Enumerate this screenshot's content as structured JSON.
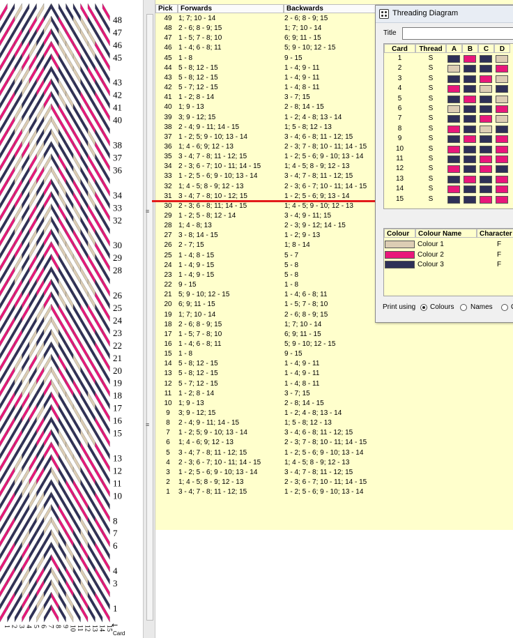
{
  "colors": {
    "colour1": "#dccdb4",
    "colour2": "#e8177a",
    "colour3": "#2e3057",
    "panel": "#ffffcc",
    "marker": "#e21b1b"
  },
  "pattern": {
    "pick_labels": [
      "48",
      "47",
      "46",
      "45",
      "43",
      "42",
      "41",
      "40",
      "38",
      "37",
      "36",
      "34",
      "33",
      "32",
      "30",
      "29",
      "28",
      "26",
      "25",
      "24",
      "23",
      "22",
      "21",
      "20",
      "19",
      "18",
      "17",
      "16",
      "15",
      "13",
      "12",
      "11",
      "10",
      "8",
      "7",
      "6",
      "4",
      "3",
      "1"
    ],
    "card_numbers": [
      "1",
      "2",
      "3",
      "4",
      "5",
      "6",
      "7",
      "8",
      "9",
      "10",
      "11",
      "12",
      "13",
      "14",
      "15"
    ],
    "card_label": "Card"
  },
  "table": {
    "headers": {
      "pick": "Pick",
      "forwards": "Forwards",
      "backwards": "Backwards"
    },
    "rows": [
      {
        "pick": "49",
        "f": "1; 7; 10 - 14",
        "b": "2 - 6; 8 - 9; 15"
      },
      {
        "pick": "48",
        "f": "2 - 6; 8 - 9; 15",
        "b": "1; 7; 10 - 14"
      },
      {
        "pick": "47",
        "f": "1 - 5; 7 - 8; 10",
        "b": "6; 9; 11 - 15"
      },
      {
        "pick": "46",
        "f": "1 - 4; 6 - 8; 11",
        "b": "5; 9 - 10; 12 - 15"
      },
      {
        "pick": "45",
        "f": "1 - 8",
        "b": "9 - 15"
      },
      {
        "pick": "44",
        "f": "5 - 8; 12 - 15",
        "b": "1 - 4; 9 - 11"
      },
      {
        "pick": "43",
        "f": "5 - 8; 12 - 15",
        "b": "1 - 4; 9 - 11"
      },
      {
        "pick": "42",
        "f": "5 - 7; 12 - 15",
        "b": "1 - 4; 8 - 11"
      },
      {
        "pick": "41",
        "f": "1 - 2; 8 - 14",
        "b": "3 - 7; 15"
      },
      {
        "pick": "40",
        "f": "1; 9 - 13",
        "b": "2 - 8; 14 - 15"
      },
      {
        "pick": "39",
        "f": "3; 9 - 12; 15",
        "b": "1 - 2; 4 - 8; 13 - 14"
      },
      {
        "pick": "38",
        "f": "2 - 4; 9 - 11; 14 - 15",
        "b": "1; 5 - 8; 12 - 13"
      },
      {
        "pick": "37",
        "f": "1 - 2; 5; 9 - 10; 13 - 14",
        "b": "3 - 4; 6 - 8; 11 - 12; 15"
      },
      {
        "pick": "36",
        "f": "1; 4 - 6; 9; 12 - 13",
        "b": "2 - 3; 7 - 8; 10 - 11; 14 - 15"
      },
      {
        "pick": "35",
        "f": "3 - 4; 7 - 8; 11 - 12; 15",
        "b": "1 - 2; 5 - 6; 9 - 10; 13 - 14"
      },
      {
        "pick": "34",
        "f": "2 - 3; 6 - 7; 10 - 11; 14 - 15",
        "b": "1; 4 - 5; 8 - 9; 12 - 13"
      },
      {
        "pick": "33",
        "f": "1 - 2; 5 - 6; 9 - 10; 13 - 14",
        "b": "3 - 4; 7 - 8; 11 - 12; 15"
      },
      {
        "pick": "32",
        "f": "1; 4 - 5; 8 - 9; 12 - 13",
        "b": "2 - 3; 6 - 7; 10 - 11; 14 - 15"
      },
      {
        "pick": "31",
        "f": "3 - 4; 7 - 8; 10 - 12; 15",
        "b": "1 - 2; 5 - 6; 9; 13 - 14"
      },
      {
        "pick": "30",
        "f": "2 - 3; 6 - 8; 11; 14 - 15",
        "b": "1; 4 - 5; 9 - 10; 12 - 13"
      },
      {
        "pick": "29",
        "f": "1 - 2; 5 - 8; 12 - 14",
        "b": "3 - 4; 9 - 11; 15"
      },
      {
        "pick": "28",
        "f": "1; 4 - 8; 13",
        "b": "2 - 3; 9 - 12; 14 - 15"
      },
      {
        "pick": "27",
        "f": "3 - 8; 14 - 15",
        "b": "1 - 2; 9 - 13"
      },
      {
        "pick": "26",
        "f": "2 - 7; 15",
        "b": "1; 8 - 14"
      },
      {
        "pick": "25",
        "f": "1 - 4; 8 - 15",
        "b": "5 - 7"
      },
      {
        "pick": "24",
        "f": "1 - 4; 9 - 15",
        "b": "5 - 8"
      },
      {
        "pick": "23",
        "f": "1 - 4; 9 - 15",
        "b": "5 - 8"
      },
      {
        "pick": "22",
        "f": "9 - 15",
        "b": "1 - 8"
      },
      {
        "pick": "21",
        "f": "5; 9 - 10; 12 - 15",
        "b": "1 - 4; 6 - 8; 11"
      },
      {
        "pick": "20",
        "f": "6; 9; 11 - 15",
        "b": "1 - 5; 7 - 8; 10"
      },
      {
        "pick": "19",
        "f": "1; 7; 10 - 14",
        "b": "2 - 6; 8 - 9; 15"
      },
      {
        "pick": "18",
        "f": "2 - 6; 8 - 9; 15",
        "b": "1; 7; 10 - 14"
      },
      {
        "pick": "17",
        "f": "1 - 5; 7 - 8; 10",
        "b": "6; 9; 11 - 15"
      },
      {
        "pick": "16",
        "f": "1 - 4; 6 - 8; 11",
        "b": "5; 9 - 10; 12 - 15"
      },
      {
        "pick": "15",
        "f": "1 - 8",
        "b": "9 - 15"
      },
      {
        "pick": "14",
        "f": "5 - 8; 12 - 15",
        "b": "1 - 4; 9 - 11"
      },
      {
        "pick": "13",
        "f": "5 - 8; 12 - 15",
        "b": "1 - 4; 9 - 11"
      },
      {
        "pick": "12",
        "f": "5 - 7; 12 - 15",
        "b": "1 - 4; 8 - 11"
      },
      {
        "pick": "11",
        "f": "1 - 2; 8 - 14",
        "b": "3 - 7; 15"
      },
      {
        "pick": "10",
        "f": "1; 9 - 13",
        "b": "2 - 8; 14 - 15"
      },
      {
        "pick": "9",
        "f": "3; 9 - 12; 15",
        "b": "1 - 2; 4 - 8; 13 - 14"
      },
      {
        "pick": "8",
        "f": "2 - 4; 9 - 11; 14 - 15",
        "b": "1; 5 - 8; 12 - 13"
      },
      {
        "pick": "7",
        "f": "1 - 2; 5; 9 - 10; 13 - 14",
        "b": "3 - 4; 6 - 8; 11 - 12; 15"
      },
      {
        "pick": "6",
        "f": "1; 4 - 6; 9; 12 - 13",
        "b": "2 - 3; 7 - 8; 10 - 11; 14 - 15"
      },
      {
        "pick": "5",
        "f": "3 - 4; 7 - 8; 11 - 12; 15",
        "b": "1 - 2; 5 - 6; 9 - 10; 13 - 14"
      },
      {
        "pick": "4",
        "f": "2 - 3; 6 - 7; 10 - 11; 14 - 15",
        "b": "1; 4 - 5; 8 - 9; 12 - 13"
      },
      {
        "pick": "3",
        "f": "1 - 2; 5 - 6; 9 - 10; 13 - 14",
        "b": "3 - 4; 7 - 8; 11 - 12; 15"
      },
      {
        "pick": "2",
        "f": "1; 4 - 5; 8 - 9; 12 - 13",
        "b": "2 - 3; 6 - 7; 10 - 11; 14 - 15"
      },
      {
        "pick": "1",
        "f": "3 - 4; 7 - 8; 11 - 12; 15",
        "b": "1 - 2; 5 - 6; 9 - 10; 13 - 14"
      }
    ]
  },
  "dialog": {
    "title": "Threading Diagram",
    "title_label": "Title",
    "title_value": "",
    "headers": {
      "card": "Card",
      "thread": "Thread",
      "a": "A",
      "b": "B",
      "c": "C",
      "d": "D"
    },
    "cards": [
      {
        "card": "1",
        "thread": "S",
        "holes": [
          3,
          2,
          3,
          1
        ]
      },
      {
        "card": "2",
        "thread": "S",
        "holes": [
          1,
          3,
          3,
          2
        ]
      },
      {
        "card": "3",
        "thread": "S",
        "holes": [
          3,
          3,
          2,
          1
        ]
      },
      {
        "card": "4",
        "thread": "S",
        "holes": [
          2,
          3,
          1,
          3
        ]
      },
      {
        "card": "5",
        "thread": "S",
        "holes": [
          3,
          2,
          3,
          1
        ]
      },
      {
        "card": "6",
        "thread": "S",
        "holes": [
          1,
          3,
          3,
          2
        ]
      },
      {
        "card": "7",
        "thread": "S",
        "holes": [
          3,
          3,
          2,
          1
        ]
      },
      {
        "card": "8",
        "thread": "S",
        "holes": [
          2,
          3,
          1,
          3
        ]
      },
      {
        "card": "9",
        "thread": "S",
        "holes": [
          3,
          2,
          3,
          2
        ]
      },
      {
        "card": "10",
        "thread": "S",
        "holes": [
          2,
          3,
          3,
          2
        ]
      },
      {
        "card": "11",
        "thread": "S",
        "holes": [
          3,
          3,
          2,
          2
        ]
      },
      {
        "card": "12",
        "thread": "S",
        "holes": [
          2,
          3,
          2,
          3
        ]
      },
      {
        "card": "13",
        "thread": "S",
        "holes": [
          3,
          2,
          3,
          2
        ]
      },
      {
        "card": "14",
        "thread": "S",
        "holes": [
          2,
          3,
          3,
          2
        ]
      },
      {
        "card": "15",
        "thread": "S",
        "holes": [
          3,
          3,
          2,
          2
        ]
      }
    ],
    "colour_headers": {
      "colour": "Colour",
      "name": "Colour Name",
      "character": "Character"
    },
    "colours": [
      {
        "name": "Colour 1",
        "character": "F",
        "hex": "#dccdb4"
      },
      {
        "name": "Colour 2",
        "character": "F",
        "hex": "#e8177a"
      },
      {
        "name": "Colour 3",
        "character": "F",
        "hex": "#2e3057"
      }
    ],
    "print_using": "Print using",
    "opt_colours": "Colours",
    "opt_names": "Names",
    "opt_third": "C"
  }
}
